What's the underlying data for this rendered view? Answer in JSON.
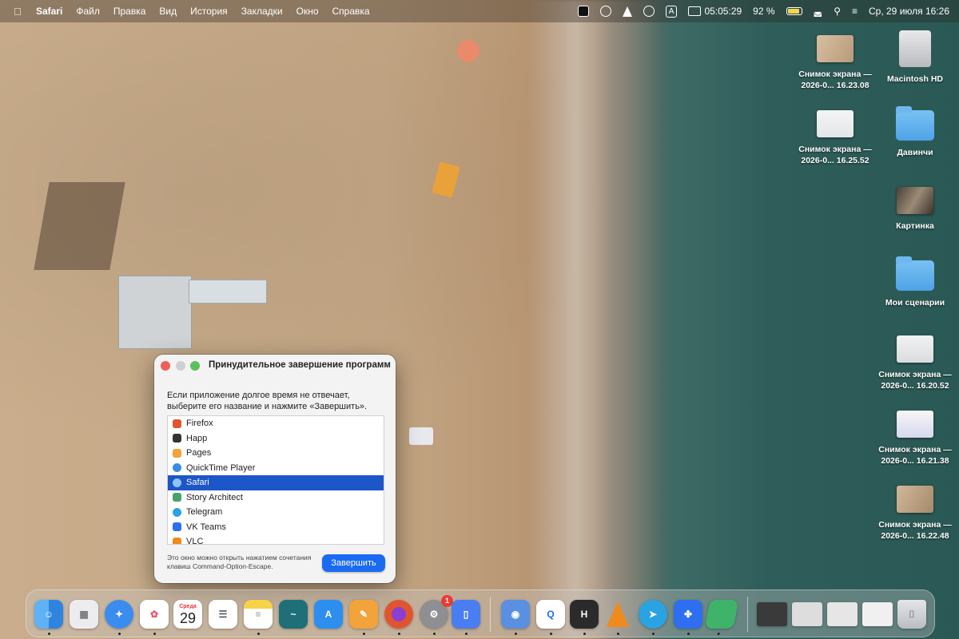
{
  "menubar": {
    "app_name": "Safari",
    "menus": [
      "Файл",
      "Правка",
      "Вид",
      "История",
      "Закладки",
      "Окно",
      "Справка"
    ],
    "clock_timer": "05:05:29",
    "battery_percent": "92 %",
    "keyboard_layout": "A",
    "date_time": "Ср, 29 июля  16:26"
  },
  "desktop": {
    "items": [
      {
        "label": "Снимок экрана — 2026-0... 16.23.08",
        "kind": "screenshot"
      },
      {
        "label": "Macintosh HD",
        "kind": "disk"
      },
      {
        "label": "Снимок экрана — 2026-0... 16.25.52",
        "kind": "screenshot"
      },
      {
        "label": "Давинчи",
        "kind": "folder"
      },
      {
        "label": "Картинка",
        "kind": "image"
      },
      {
        "label": "Мои сценарии",
        "kind": "folder-alias"
      },
      {
        "label": "Снимок экрана — 2026-0... 16.20.52",
        "kind": "screenshot"
      },
      {
        "label": "Снимок экрана — 2026-0... 16.21.38",
        "kind": "screenshot"
      },
      {
        "label": "Снимок экрана — 2026-0... 16.22.48",
        "kind": "screenshot"
      }
    ]
  },
  "force_quit": {
    "title": "Принудительное завершение программ",
    "description": "Если приложение долгое время не отвечает, выберите его название и нажмите «Завершить».",
    "apps": [
      {
        "name": "Firefox",
        "color": "#e0552d",
        "selected": false
      },
      {
        "name": "Happ",
        "color": "#333333",
        "selected": false
      },
      {
        "name": "Pages",
        "color": "#f2a33a",
        "selected": false
      },
      {
        "name": "QuickTime Player",
        "color": "#3d8be6",
        "selected": false
      },
      {
        "name": "Safari",
        "color": "#3b8cf0",
        "selected": true
      },
      {
        "name": "Story Architect",
        "color": "#45a36a",
        "selected": false
      },
      {
        "name": "Telegram",
        "color": "#2aa3e2",
        "selected": false
      },
      {
        "name": "VK Teams",
        "color": "#2d6ff0",
        "selected": false
      },
      {
        "name": "VLC",
        "color": "#f08a1c",
        "selected": false
      }
    ],
    "hint": "Это окно можно открыть нажатием сочетания клавиш Command-Option-Escape.",
    "quit_button": "Завершить"
  },
  "dock": {
    "calendar_month": "Среда",
    "calendar_day": "29",
    "settings_badge": "1",
    "apps": [
      {
        "name": "finder",
        "color": "#3b8ee8"
      },
      {
        "name": "launchpad",
        "color": "#e9e9ee"
      },
      {
        "name": "safari",
        "color": "#3b8cf0"
      },
      {
        "name": "photos",
        "color": "#ffffff"
      },
      {
        "name": "calendar",
        "color": "#ffffff"
      },
      {
        "name": "reminders",
        "color": "#ffffff"
      },
      {
        "name": "notes",
        "color": "#f7d24a"
      },
      {
        "name": "freeform",
        "color": "#1f6f78"
      },
      {
        "name": "app-store",
        "color": "#2d8ef0"
      },
      {
        "name": "pages",
        "color": "#f2a33a"
      },
      {
        "name": "firefox",
        "color": "#e0552d"
      },
      {
        "name": "system-settings",
        "color": "#8e8e93"
      },
      {
        "name": "simulator",
        "color": "#4a7df0"
      },
      {
        "name": "anka",
        "color": "#5b8fe0"
      },
      {
        "name": "quicktime",
        "color": "#1c6ee0"
      },
      {
        "name": "happ",
        "color": "#2b2b2b"
      },
      {
        "name": "vlc",
        "color": "#f08a1c"
      },
      {
        "name": "telegram",
        "color": "#2aa3e2"
      },
      {
        "name": "vk-teams",
        "color": "#2d6ff0"
      },
      {
        "name": "story-architect",
        "color": "#3fb36a"
      },
      {
        "name": "recent-window-1",
        "color": "#3a3a3a"
      },
      {
        "name": "recent-window-2",
        "color": "#dddddd"
      },
      {
        "name": "recent-window-3",
        "color": "#e6e6e6"
      },
      {
        "name": "recent-window-4",
        "color": "#f0f0f0"
      },
      {
        "name": "trash",
        "color": "#c9cdd2"
      }
    ]
  }
}
